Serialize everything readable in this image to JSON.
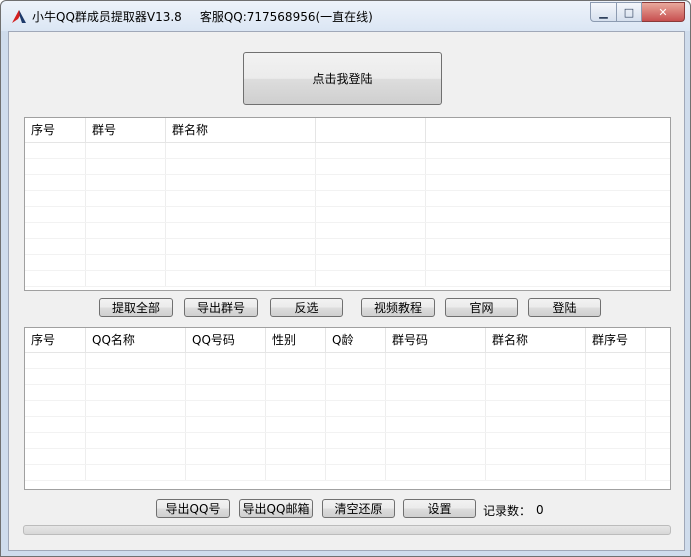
{
  "window": {
    "title": "小牛QQ群成员提取器V13.8",
    "service": "客服QQ:717568956(一直在线)",
    "minimize_glyph": "▁",
    "maximize_glyph": "□",
    "close_glyph": "✕"
  },
  "login_button": "点击我登陆",
  "groups_table": {
    "headers": [
      "序号",
      "群号",
      "群名称",
      "",
      ""
    ]
  },
  "group_actions": {
    "extract_all": "提取全部",
    "export_groups": "导出群号",
    "invert": "反选",
    "video_tutorial": "视频教程",
    "official_site": "官网",
    "login": "登陆"
  },
  "members_table": {
    "headers": [
      "序号",
      "QQ名称",
      "QQ号码",
      "性别",
      "Q龄",
      "群号码",
      "群名称",
      "群序号",
      ""
    ]
  },
  "member_actions": {
    "export_qq": "导出QQ号",
    "export_email": "导出QQ邮箱",
    "clear_reset": "清空还原",
    "settings": "设置"
  },
  "record_count": {
    "label": "记录数：",
    "value": "0"
  },
  "progress": 0,
  "colors": {
    "icon_red": "#d42020",
    "close_red": "#c75050"
  },
  "icons": [
    "app-logo-icon",
    "minimize-icon",
    "maximize-icon",
    "close-icon"
  ]
}
